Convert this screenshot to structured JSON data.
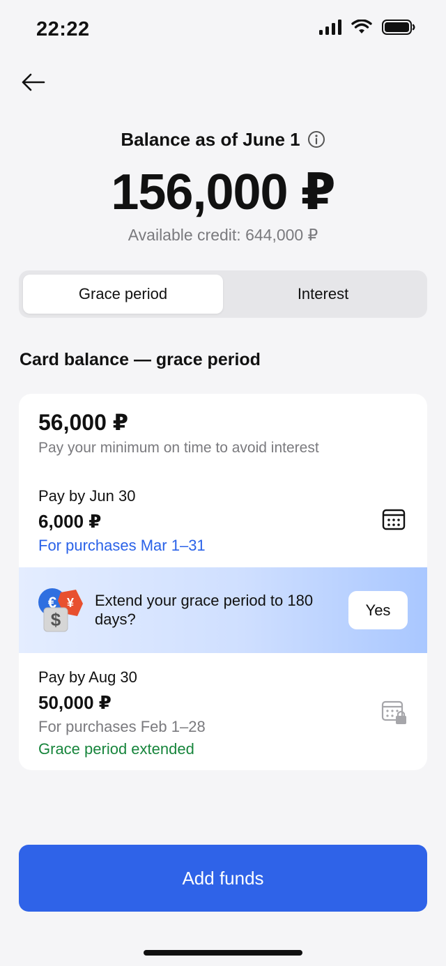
{
  "status_bar": {
    "time": "22:22",
    "icons": [
      "signal-icon",
      "wifi-icon",
      "battery-icon"
    ]
  },
  "nav": {
    "back_icon": "arrow-left-icon"
  },
  "header": {
    "balance_label": "Balance as of June 1",
    "info_icon": "info-icon",
    "balance_amount": "156,000 ₽",
    "available_credit": "Available credit: 644,000 ₽"
  },
  "tabs": [
    {
      "label": "Grace period",
      "active": true
    },
    {
      "label": "Interest",
      "active": false
    }
  ],
  "section": {
    "title": "Card balance — grace period"
  },
  "card": {
    "total": "56,000 ₽",
    "subtitle": "Pay your minimum on time to avoid interest",
    "payment1": {
      "label": "Pay by Jun 30",
      "amount": "6,000 ₽",
      "link": "For purchases Mar 1–31",
      "icon": "calendar-icon"
    },
    "promo": {
      "icon": "currency-exchange-icon",
      "text": "Extend your grace period to 180 days?",
      "button": "Yes"
    },
    "payment2": {
      "label": "Pay by Aug 30",
      "amount": "50,000 ₽",
      "note": "For purchases Feb 1–28",
      "status": "Grace period extended",
      "icon": "calendar-locked-icon"
    }
  },
  "footer": {
    "button": "Add funds"
  },
  "colors": {
    "accent": "#2f63e8",
    "link": "#2a62e8",
    "success": "#17853c",
    "muted_text": "#7a7a7e",
    "background": "#f5f5f7"
  }
}
